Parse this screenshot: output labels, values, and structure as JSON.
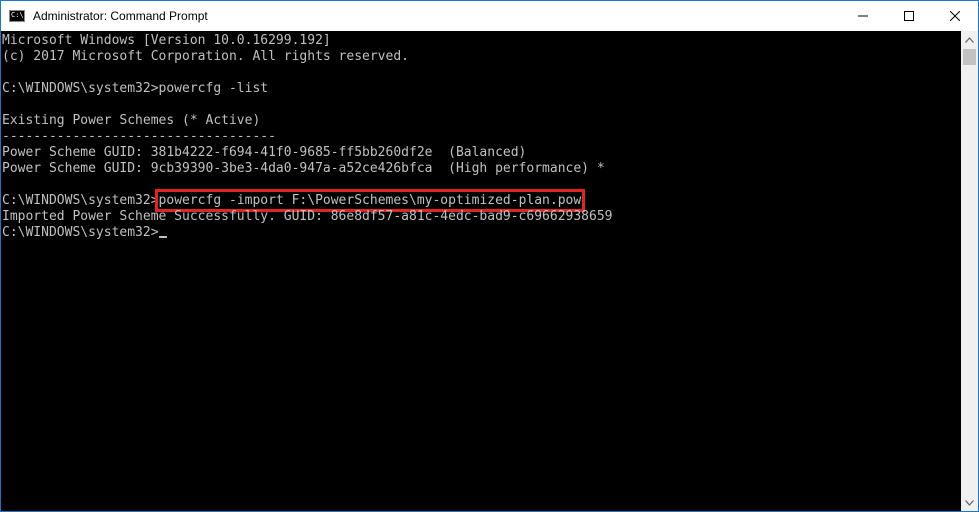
{
  "window": {
    "title": "Administrator: Command Prompt",
    "icon_label": "C:\\"
  },
  "console": {
    "lines": [
      "Microsoft Windows [Version 10.0.16299.192]",
      "(c) 2017 Microsoft Corporation. All rights reserved.",
      "",
      "C:\\WINDOWS\\system32>powercfg -list",
      "",
      "Existing Power Schemes (* Active)",
      "-----------------------------------",
      "Power Scheme GUID: 381b4222-f694-41f0-9685-ff5bb260df2e  (Balanced)",
      "Power Scheme GUID: 9cb39390-3be3-4da0-947a-a52ce426bfca  (High performance) *",
      "",
      "",
      "Imported Power Scheme Successfully. GUID: 86e8df57-a81c-4edc-bad9-c69662938659",
      ""
    ],
    "import_prompt": "C:\\WINDOWS\\system32>",
    "import_command": "powercfg -import F:\\PowerSchemes\\my-optimized-plan.pow",
    "final_prompt": "C:\\WINDOWS\\system32>"
  },
  "colors": {
    "highlight": "#e02424",
    "console_text": "#c0c0c0",
    "console_bg": "#000000",
    "titlebar_bg": "#ffffff"
  },
  "icons": {
    "app": "cmd-icon",
    "minimize": "minimize-icon",
    "maximize": "maximize-icon",
    "close": "close-icon"
  }
}
